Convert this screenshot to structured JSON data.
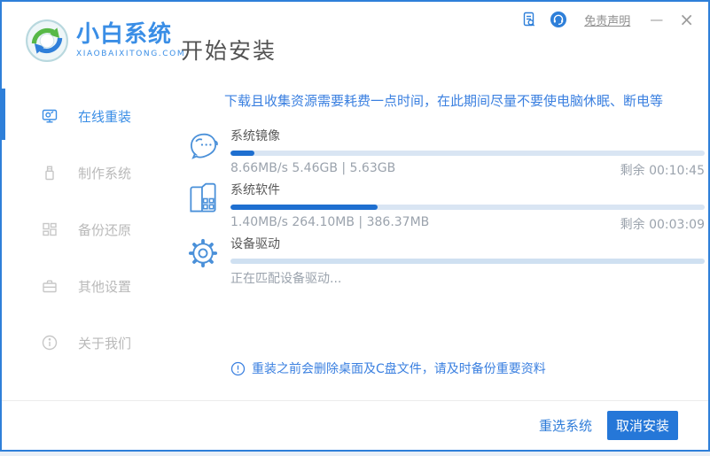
{
  "brand": {
    "name": "小白系统",
    "domain": "XIAOBAIXITONG.COM"
  },
  "header": {
    "page_title": "开始安装"
  },
  "titlebar": {
    "disclaimer": "免责声明",
    "minimize": "—",
    "close": "×"
  },
  "sidebar": {
    "items": [
      {
        "label": "在线重装",
        "icon": "monitor-icon",
        "active": true
      },
      {
        "label": "制作系统",
        "icon": "usb-icon",
        "active": false
      },
      {
        "label": "备份还原",
        "icon": "blocks-icon",
        "active": false
      },
      {
        "label": "其他设置",
        "icon": "briefcase-icon",
        "active": false
      },
      {
        "label": "关于我们",
        "icon": "info-icon",
        "active": false
      }
    ]
  },
  "main": {
    "notice": "下载且收集资源需要耗费一点时间，在此期间尽量不要使电脑休眠、断电等",
    "tasks": [
      {
        "name": "系统镜像",
        "icon": "mascot-face-icon",
        "progress_percent": 5,
        "detail": "8.66MB/s 5.46GB | 5.63GB",
        "remaining": "剩余 00:10:45"
      },
      {
        "name": "系统软件",
        "icon": "folder-grid-icon",
        "progress_percent": 31,
        "detail": "1.40MB/s 264.10MB | 386.37MB",
        "remaining": "剩余 00:03:09"
      },
      {
        "name": "设备驱动",
        "icon": "gear-icon",
        "progress_percent": 0,
        "detail": "正在匹配设备驱动...",
        "remaining": ""
      }
    ],
    "warning": "重装之前会删除桌面及C盘文件，请及时备份重要资料"
  },
  "footer": {
    "reselect_label": "重选系统",
    "cancel_label": "取消安装"
  },
  "colors": {
    "accent_blue": "#2e7fd9",
    "brand_blue": "#3a8ee6",
    "progress_fill": "#1e6fd0",
    "progress_track": "#d9e5f3",
    "notice_blue": "#3b80e0",
    "muted_gray": "#9ba3ad",
    "button_blue": "#2577d8"
  }
}
